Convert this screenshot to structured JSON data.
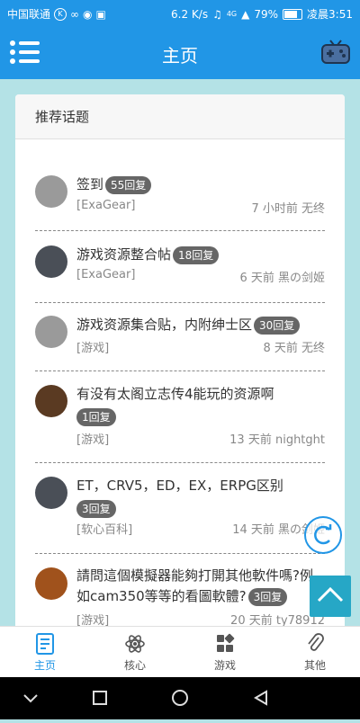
{
  "status_bar": {
    "carrier": "中国联通",
    "speed": "6.2 K/s",
    "network": "4G",
    "battery": "79%",
    "time": "凌晨3:51"
  },
  "app_bar": {
    "title": "主页"
  },
  "section": {
    "title": "推荐话题"
  },
  "topics": [
    {
      "title": "签到",
      "badge": "55回复",
      "category": "[ExaGear]",
      "meta": "7 小时前 无终"
    },
    {
      "title": "游戏资源整合帖",
      "badge": "18回复",
      "category": "[ExaGear]",
      "meta": "6 天前 黑の剑姬"
    },
    {
      "title": "游戏资源集合贴，内附绅士区",
      "badge": "30回复",
      "category": "[游戏]",
      "meta": "8 天前 无终"
    },
    {
      "title": "有没有太阁立志传4能玩的资源啊",
      "badge": "1回复",
      "category": "[游戏]",
      "meta": "13 天前 nightght"
    },
    {
      "title": "ET，CRV5，ED，EX，ERPG区别",
      "badge": "3回复",
      "category": "[软心百科]",
      "meta": "14 天前 黑の剑姬"
    },
    {
      "title": "請問這個模擬器能夠打開其他軟件嗎?例如cam350等等的看圖軟體?",
      "badge": "3回复",
      "category": "[游戏]",
      "meta": "20 天前 ty78912"
    }
  ],
  "bottom_nav": [
    {
      "label": "主页",
      "active": true
    },
    {
      "label": "核心"
    },
    {
      "label": "游戏"
    },
    {
      "label": "其他"
    }
  ],
  "colors": {
    "primary": "#2196e6",
    "background": "#b4e2e6",
    "badge": "#666666"
  }
}
